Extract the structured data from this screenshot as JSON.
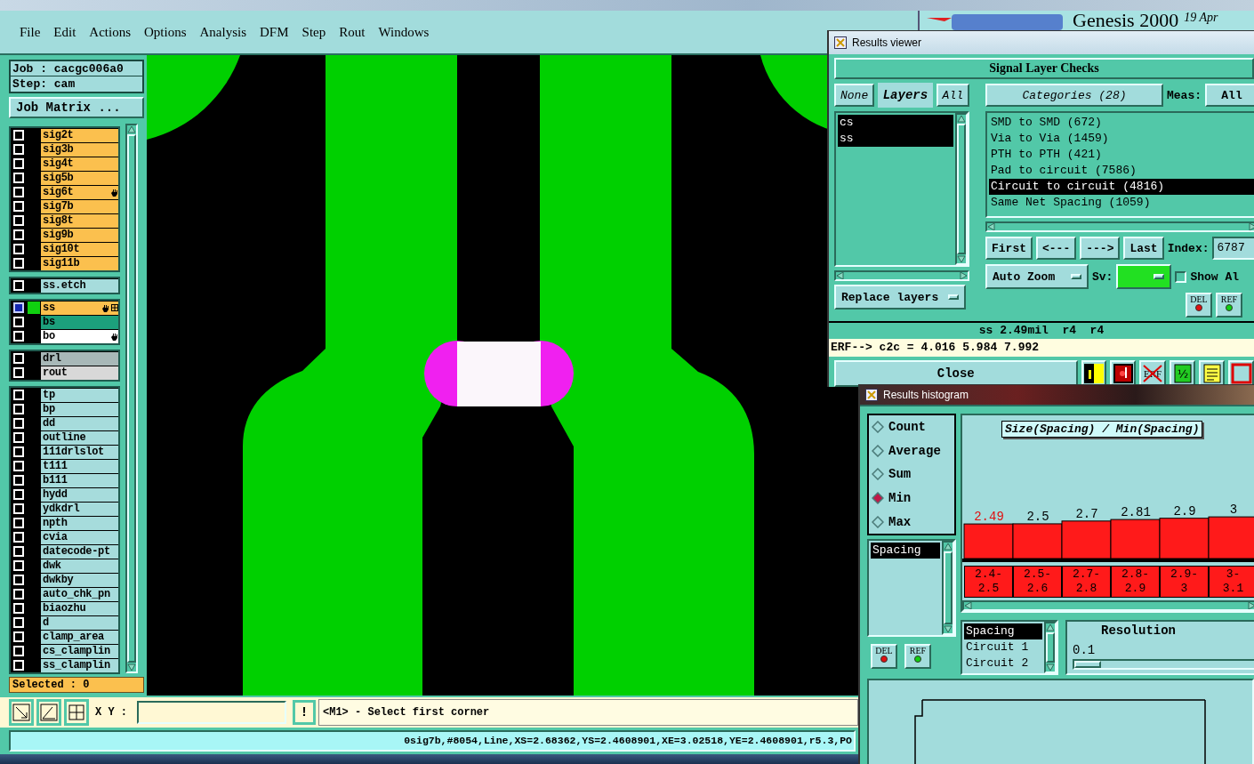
{
  "main_window": {
    "menu": [
      "File",
      "Edit",
      "Actions",
      "Options",
      "Analysis",
      "DFM",
      "Step",
      "Rout",
      "Windows"
    ],
    "logo": {
      "title": "Genesis 2000",
      "date": "19 Apr"
    },
    "job": "Job : cacgc006a0",
    "step": "Step: cam",
    "job_matrix_button": "Job Matrix ...",
    "layer_groups": [
      {
        "layers": [
          {
            "name": "sig2t",
            "color": "#fbc04e",
            "selected": false,
            "hand": false,
            "grid": false
          },
          {
            "name": "sig3b",
            "color": "#fbc04e",
            "selected": false,
            "hand": false,
            "grid": false
          },
          {
            "name": "sig4t",
            "color": "#fbc04e",
            "selected": false,
            "hand": false,
            "grid": false
          },
          {
            "name": "sig5b",
            "color": "#fbc04e",
            "selected": false,
            "hand": false,
            "grid": false
          },
          {
            "name": "sig6t",
            "color": "#fbc04e",
            "selected": false,
            "hand": true,
            "grid": false
          },
          {
            "name": "sig7b",
            "color": "#fbc04e",
            "selected": false,
            "hand": false,
            "grid": false
          },
          {
            "name": "sig8t",
            "color": "#fbc04e",
            "selected": false,
            "hand": false,
            "grid": false
          },
          {
            "name": "sig9b",
            "color": "#fbc04e",
            "selected": false,
            "hand": false,
            "grid": false
          },
          {
            "name": "sig10t",
            "color": "#fbc04e",
            "selected": false,
            "hand": false,
            "grid": false
          },
          {
            "name": "sig11b",
            "color": "#fbc04e",
            "selected": false,
            "hand": false,
            "grid": false
          }
        ]
      },
      {
        "layers": [
          {
            "name": "ss.etch",
            "color": "#a6dcdc",
            "selected": false,
            "hand": false,
            "grid": false
          }
        ]
      },
      {
        "layers": [
          {
            "name": "ss",
            "color": "#fbc04e",
            "selected": true,
            "hand": true,
            "grid": true
          },
          {
            "name": "bs",
            "color": "#1ca07c",
            "selected": false,
            "hand": false,
            "grid": false
          },
          {
            "name": "bo",
            "color": "#ffffff",
            "selected": false,
            "hand": true,
            "grid": false
          }
        ]
      },
      {
        "layers": [
          {
            "name": "drl",
            "color": "#a8b8b8",
            "selected": false,
            "hand": false,
            "grid": false
          },
          {
            "name": "rout",
            "color": "#d8d8d8",
            "selected": false,
            "hand": false,
            "grid": false
          }
        ]
      },
      {
        "layers": [
          {
            "name": "tp",
            "color": "#a6dcdc",
            "selected": false,
            "hand": false,
            "grid": false
          },
          {
            "name": "bp",
            "color": "#a6dcdc",
            "selected": false,
            "hand": false,
            "grid": false
          },
          {
            "name": "dd",
            "color": "#a6dcdc",
            "selected": false,
            "hand": false,
            "grid": false
          },
          {
            "name": "outline",
            "color": "#a6dcdc",
            "selected": false,
            "hand": false,
            "grid": false
          },
          {
            "name": "111drlslot",
            "color": "#a6dcdc",
            "selected": false,
            "hand": false,
            "grid": false
          },
          {
            "name": "t111",
            "color": "#a6dcdc",
            "selected": false,
            "hand": false,
            "grid": false
          },
          {
            "name": "b111",
            "color": "#a6dcdc",
            "selected": false,
            "hand": false,
            "grid": false
          },
          {
            "name": "hydd",
            "color": "#a6dcdc",
            "selected": false,
            "hand": false,
            "grid": false
          },
          {
            "name": "ydkdrl",
            "color": "#a6dcdc",
            "selected": false,
            "hand": false,
            "grid": false
          },
          {
            "name": "npth",
            "color": "#a6dcdc",
            "selected": false,
            "hand": false,
            "grid": false
          },
          {
            "name": "cvia",
            "color": "#a6dcdc",
            "selected": false,
            "hand": false,
            "grid": false
          },
          {
            "name": "datecode-pt",
            "color": "#a6dcdc",
            "selected": false,
            "hand": false,
            "grid": false
          },
          {
            "name": "dwk",
            "color": "#a6dcdc",
            "selected": false,
            "hand": false,
            "grid": false
          },
          {
            "name": "dwkby",
            "color": "#a6dcdc",
            "selected": false,
            "hand": false,
            "grid": false
          },
          {
            "name": "auto_chk_pn",
            "color": "#a6dcdc",
            "selected": false,
            "hand": false,
            "grid": false
          },
          {
            "name": "biaozhu",
            "color": "#a6dcdc",
            "selected": false,
            "hand": false,
            "grid": false
          },
          {
            "name": "d",
            "color": "#a6dcdc",
            "selected": false,
            "hand": false,
            "grid": false
          },
          {
            "name": "clamp_area",
            "color": "#a6dcdc",
            "selected": false,
            "hand": false,
            "grid": false
          },
          {
            "name": "cs_clamplin",
            "color": "#a6dcdc",
            "selected": false,
            "hand": false,
            "grid": false
          },
          {
            "name": "ss_clamplin",
            "color": "#a6dcdc",
            "selected": false,
            "hand": false,
            "grid": false
          }
        ]
      }
    ],
    "selected_count": "Selected : 0",
    "toolbar": {
      "xy_label": "X Y :",
      "alert_button": "!",
      "prompt": "<M1> - Select first corner"
    },
    "status_line": "0sig7b,#8054,Line,XS=2.68362,YS=2.4608901,XE=3.02518,YE=2.4608901,r5.3,PO"
  },
  "results_viewer": {
    "title": "Results viewer",
    "header": "Signal Layer Checks",
    "none_button": "None",
    "layers_label": "Layers",
    "all_button": "All",
    "layers": [
      {
        "name": "cs",
        "selected": true
      },
      {
        "name": "ss",
        "selected": true
      }
    ],
    "replace_layers": "Replace layers",
    "categories_button": "Categories (28)",
    "meas_label": "Meas:",
    "meas_value": "All",
    "categories": [
      {
        "label": "SMD to SMD (672)",
        "selected": false
      },
      {
        "label": "Via to Via (1459)",
        "selected": false
      },
      {
        "label": "PTH to PTH (421)",
        "selected": false
      },
      {
        "label": "Pad to circuit (7586)",
        "selected": false
      },
      {
        "label": "Circuit to circuit (4816)",
        "selected": true
      },
      {
        "label": "Same Net Spacing (1059)",
        "selected": false
      }
    ],
    "nav_buttons": [
      "First",
      "<---",
      "--->",
      "Last"
    ],
    "index_label": "Index:",
    "index_value": "6787",
    "zoom_mode": "Auto Zoom",
    "sv_label": "Sv:",
    "show_all": {
      "label": "Show Al",
      "checked": false
    },
    "mark_buttons": [
      "DEL",
      "REF"
    ],
    "measurement": "ss 2.49mil  r4  r4",
    "erf_line": "ERF--> c2c = 4.016 5.984 7.992",
    "close_button": "Close",
    "tool_buttons": [
      {
        "kind": "split"
      },
      {
        "kind": "record"
      },
      {
        "kind": "erf",
        "label": "ERF"
      },
      {
        "kind": "page",
        "label": "½"
      },
      {
        "kind": "notes"
      },
      {
        "kind": "frame"
      }
    ]
  },
  "results_histogram": {
    "title": "Results histogram",
    "modes": [
      {
        "label": "Count",
        "selected": false
      },
      {
        "label": "Average",
        "selected": false
      },
      {
        "label": "Sum",
        "selected": false
      },
      {
        "label": "Min",
        "selected": true
      },
      {
        "label": "Max",
        "selected": false
      }
    ],
    "attributes": [
      {
        "label": "Spacing",
        "selected": true
      }
    ],
    "mark_buttons": [
      "DEL",
      "REF"
    ],
    "chart_data": {
      "type": "bar",
      "title": "Size(Spacing) / Min(Spacing)",
      "categories": [
        "2.4-2.5",
        "2.5-2.6",
        "2.7-2.8",
        "2.8-2.9",
        "2.9-3",
        "3-3.1"
      ],
      "values": [
        2.49,
        2.5,
        2.7,
        2.81,
        2.9,
        3
      ],
      "ylim": [
        0,
        3.2
      ],
      "data_labels": true
    },
    "fields": [
      {
        "label": "Spacing",
        "selected": true
      },
      {
        "label": "Circuit 1",
        "selected": false
      },
      {
        "label": "Circuit 2",
        "selected": false
      }
    ],
    "resolution_label": "Resolution",
    "resolution_value": "0.1",
    "resolution_slider": {
      "level": 0
    }
  }
}
